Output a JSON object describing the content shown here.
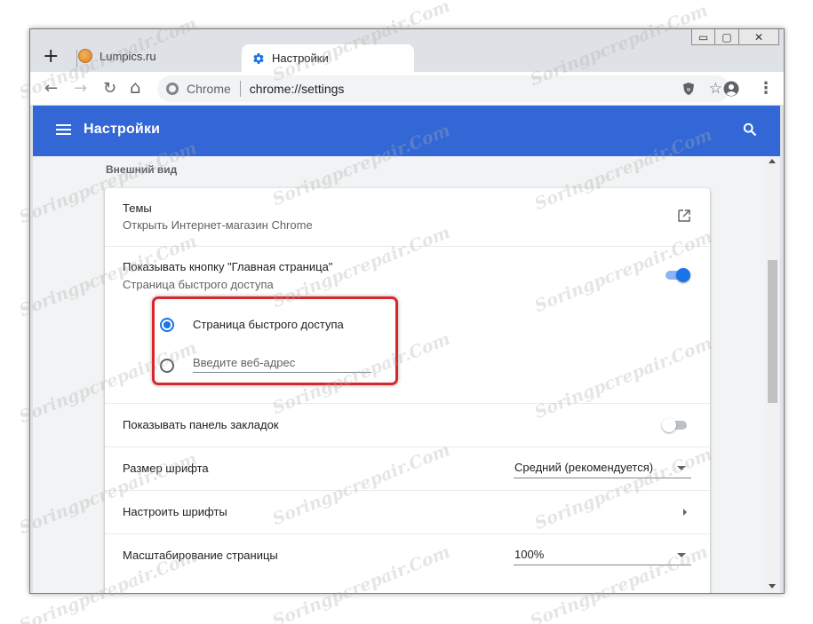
{
  "window": {
    "controls": {
      "minimize": "▭",
      "restore": "▢",
      "close": "✕"
    }
  },
  "tabs": [
    {
      "title": "Lumpics.ru",
      "icon": "lumpics-favicon",
      "active": false
    },
    {
      "title": "Настройки",
      "icon": "gear-icon",
      "active": true
    }
  ],
  "toolbar": {
    "new_tab": "+",
    "back": "←",
    "forward": "→",
    "reload": "↻",
    "home": "⌂",
    "omnibox_chip": "Chrome",
    "url": "chrome://settings",
    "star": "☆",
    "menu": "⋮"
  },
  "header": {
    "title": "Настройки",
    "accent_color": "#3367d6"
  },
  "section": {
    "title": "Внешний вид"
  },
  "settings": {
    "themes": {
      "label": "Темы",
      "sublabel": "Открыть Интернет-магазин Chrome"
    },
    "home_button": {
      "label": "Показывать кнопку \"Главная страница\"",
      "sublabel": "Страница быстрого доступа",
      "enabled": true,
      "options": [
        {
          "label": "Страница быстрого доступа",
          "selected": true
        },
        {
          "placeholder": "Введите веб-адрес",
          "selected": false
        }
      ]
    },
    "bookmarks_bar": {
      "label": "Показывать панель закладок",
      "enabled": false
    },
    "font_size": {
      "label": "Размер шрифта",
      "value": "Средний (рекомендуется)"
    },
    "customize_fonts": {
      "label": "Настроить шрифты"
    },
    "page_zoom": {
      "label": "Масштабирование страницы",
      "value": "100%"
    }
  },
  "watermark": "Soringpcrepair.Com",
  "highlight_color": "#d9262b",
  "toggle_on_color": "#1a73e8"
}
